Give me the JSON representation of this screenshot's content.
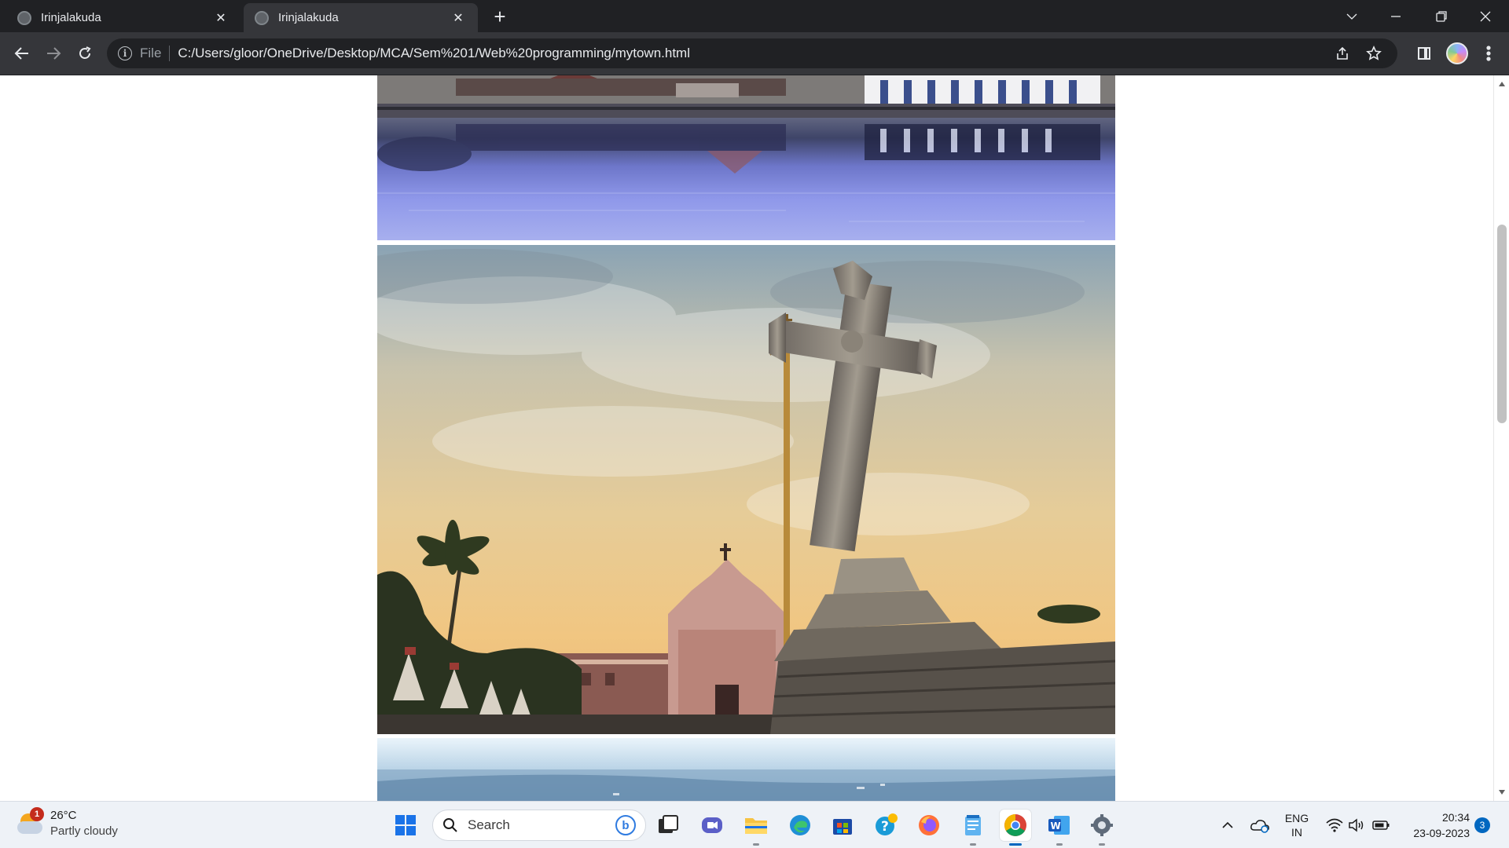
{
  "browser": {
    "tabs": [
      {
        "title": "Irinjalakuda",
        "active": false
      },
      {
        "title": "Irinjalakuda",
        "active": true
      }
    ],
    "address": {
      "scheme_label": "File",
      "url": "C:/Users/gloor/OneDrive/Desktop/MCA/Sem%201/Web%20programming/mytown.html"
    }
  },
  "page": {
    "images": [
      {
        "subject": "temple pond reflection"
      },
      {
        "subject": "church with cross and flagpole at sunset"
      },
      {
        "subject": "aerial view of town"
      }
    ],
    "scroll_fraction": 0.27
  },
  "taskbar": {
    "weather": {
      "temperature": "26°C",
      "condition": "Partly cloudy",
      "badge": "1"
    },
    "search_placeholder": "Search",
    "apps": [
      "windows-start",
      "search",
      "task-view",
      "teams-chat",
      "file-explorer",
      "edge",
      "microsoft-store",
      "help",
      "firefox",
      "notepad",
      "chrome",
      "word",
      "settings"
    ],
    "language": {
      "line1": "ENG",
      "line2": "IN"
    },
    "clock": {
      "time": "20:34",
      "date": "23-09-2023"
    },
    "notifications": "3"
  }
}
